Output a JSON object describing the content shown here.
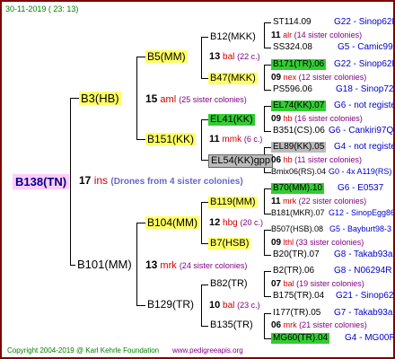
{
  "header": {
    "date": "30-11-2019 ( 23: 13)"
  },
  "footer": {
    "copyright": "Copyright 2004-2019 @ Karl Kehrle Foundation",
    "site": "www.pedigreeapis.org"
  },
  "colors": {
    "border": "#800000",
    "highlight_yellow": "#ffff66",
    "highlight_green": "#33cc33",
    "highlight_gray": "#bbbbbb",
    "root_bg": "#ffccff"
  },
  "root": {
    "name": "B138(TN)",
    "count": "17",
    "abbr": "ins",
    "note": "(Drones from 4 sister colonies)"
  },
  "b3": {
    "name": "B3(HB)",
    "count": "15",
    "abbr": "aml",
    "note": "(25 sister colonies)"
  },
  "b101": {
    "name": "B101(MM)",
    "count": "13",
    "abbr": "mrk",
    "note": "(24 sister colonies)"
  },
  "b5": {
    "name": "B5(MM)"
  },
  "b151": {
    "name": "B151(KK)",
    "count": "11",
    "abbr": "mmk",
    "note": "(6 c.)"
  },
  "b104": {
    "name": "B104(MM)",
    "count": "12",
    "abbr": "hbg",
    "note": "(20 c.)"
  },
  "b129": {
    "name": "B129(TR)",
    "count": "10",
    "abbr": "bal",
    "note": "(23 c.)"
  },
  "b5_mid": {
    "count": "13",
    "abbr": "bal",
    "note": "(22 c.)"
  },
  "b12": {
    "name": "B12(MKK)",
    "count": "11",
    "abbr": "alr",
    "note": "(14 sister colonies)"
  },
  "b47": {
    "name": "B47(MKK)",
    "count": "09",
    "abbr": "nex",
    "note": "(12 sister colonies)"
  },
  "el41": {
    "name": "EL41(KK)",
    "count": "09",
    "abbr": "hb",
    "note": "(16 sister colonies)"
  },
  "el54": {
    "name": "EL54(KK)gpp",
    "count": "06",
    "abbr": "hb",
    "note": "(11 sister colonies)"
  },
  "b119": {
    "name": "B119(MM)",
    "count": "11",
    "abbr": "mrk",
    "note": "(22 sister colonies)"
  },
  "b7": {
    "name": "B7(HSB)",
    "count": "09",
    "abbr": "lthl",
    "note": "(33 sister colonies)"
  },
  "b82": {
    "name": "B82(TR)",
    "count": "07",
    "abbr": "bal",
    "note": "(19 sister colonies)"
  },
  "b135": {
    "name": "B135(TR)",
    "count": "06",
    "abbr": "mrk",
    "note": "(21 sister colonies)"
  },
  "leaves": [
    {
      "name": "ST114.09",
      "ref": "G22 - Sinop62R"
    },
    {
      "name": "SS324.08",
      "ref": "G5 - Camic99R"
    },
    {
      "name": "B171(TR).06",
      "ref": "G22 - Sinop62R"
    },
    {
      "name": "PS596.06",
      "ref": "G18 - Sinop72R"
    },
    {
      "name": "EL74(KK).07",
      "ref": "G6 - not registe"
    },
    {
      "name": "B351(CS).06",
      "ref": "G6 - Cankiri97Q"
    },
    {
      "name": "EL89(KK).05",
      "ref": "G4 - not registe"
    },
    {
      "name": "Bmix06(RS).04",
      "ref": "G0 - 4x A119(RS)"
    },
    {
      "name": "B70(MM).10",
      "ref": "G6 - E0537"
    },
    {
      "name": "B181(MKR).07",
      "ref": "G12 - SinopEgg86R"
    },
    {
      "name": "B507(HSB).08",
      "ref": "G5 - Bayburt98-3"
    },
    {
      "name": "B20(TR).07",
      "ref": "G8 - Takab93aR"
    },
    {
      "name": "B2(TR).06",
      "ref": "G8 - N06294R"
    },
    {
      "name": "B175(TR).04",
      "ref": "G21 - Sinop62R"
    },
    {
      "name": "I177(TR).05",
      "ref": "G7 - Takab93aR"
    },
    {
      "name": "MG60(TR).04",
      "ref": "G4 - MG00R"
    }
  ]
}
